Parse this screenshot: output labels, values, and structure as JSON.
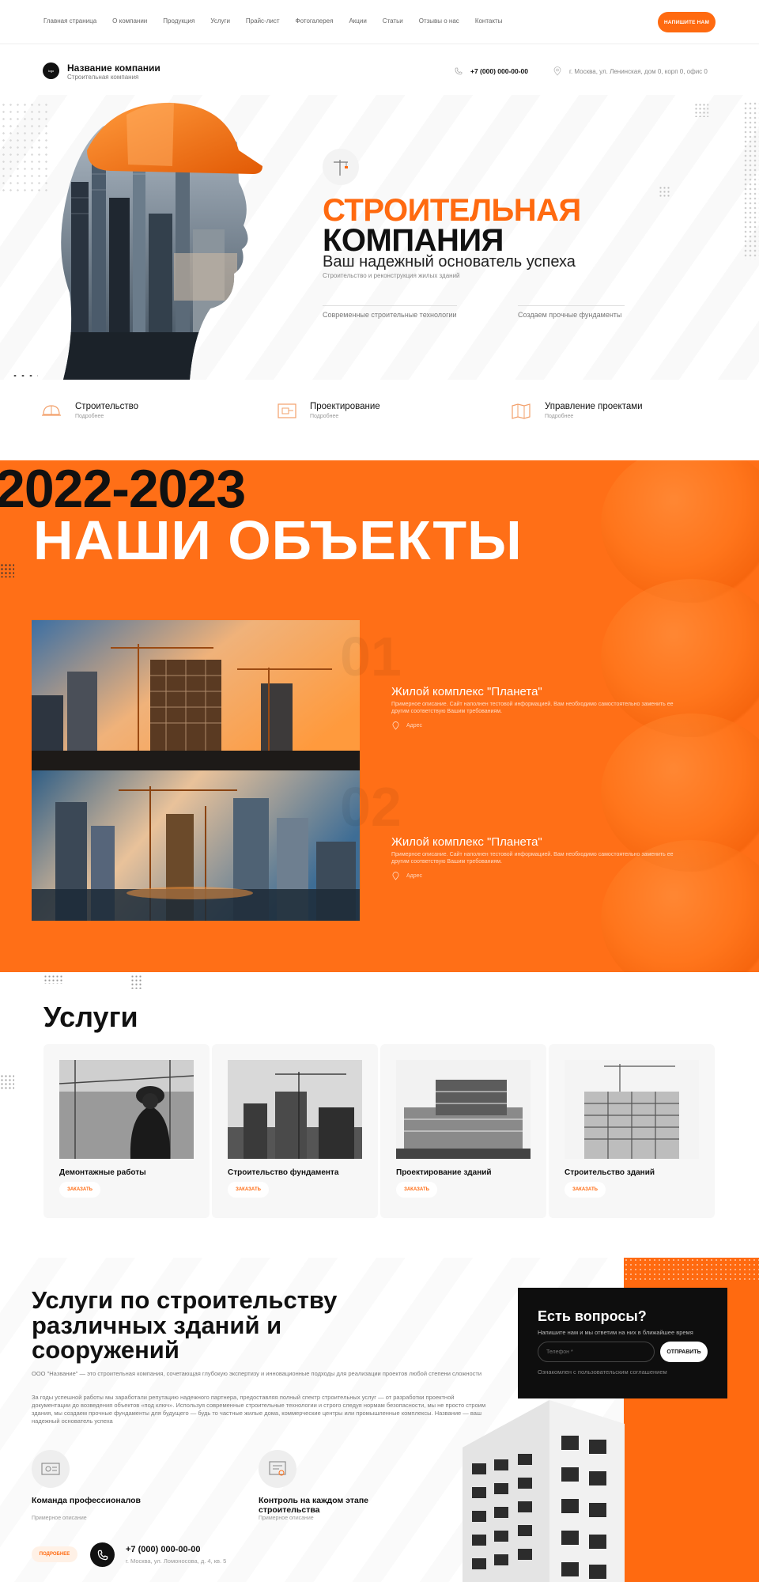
{
  "nav": {
    "items": [
      "Главная страница",
      "О компании",
      "Продукция",
      "Услуги",
      "Прайс-лист",
      "Фотогалерея",
      "Акции",
      "Статьи",
      "Отзывы о нас",
      "Контакты"
    ],
    "cta": "НАПИШИТЕ НАМ"
  },
  "header": {
    "logo_text": "logo",
    "company_name": "Название компании",
    "company_sub": "Строительная компания",
    "phone": "+7 (000) 000-00-00",
    "address": "г. Москва, ул. Ленинская, дом 0, корп 0, офис 0"
  },
  "hero": {
    "title_line1": "СТРОИТЕЛЬНАЯ",
    "title_line2": "КОМПАНИЯ",
    "tagline": "Ваш надежный основатель успеха",
    "subtitle": "Строительство и реконструкция жилых зданий",
    "feature1": "Современные строительные технологии",
    "feature2": "Создаем прочные фундаменты"
  },
  "services_strip": [
    {
      "title": "Строительство",
      "more": "Подробнее"
    },
    {
      "title": "Проектирование",
      "more": "Подробнее"
    },
    {
      "title": "Управление проектами",
      "more": "Подробнее"
    }
  ],
  "objects": {
    "year": "2022-2023",
    "title": "НАШИ ОБЪЕКТЫ",
    "items": [
      {
        "num": "01",
        "title": "Жилой комплекс \"Планета\"",
        "desc": "Примерное описание. Сайт наполнен тестовой информацией. Вам необходимо самостоятельно заменить ее другим соответствую Вашим требованиям.",
        "address": "Адрес"
      },
      {
        "num": "02",
        "title": "Жилой комплекс \"Планета\"",
        "desc": "Примерное описание. Сайт наполнен тестовой информацией. Вам необходимо самостоятельно заменить ее другим соответствую Вашим требованиям.",
        "address": "Адрес"
      }
    ]
  },
  "services": {
    "title": "Услуги",
    "cards": [
      {
        "title": "Демонтажные работы",
        "button": "ЗАКАЗАТЬ"
      },
      {
        "title": "Строительство фундамента",
        "button": "ЗАКАЗАТЬ"
      },
      {
        "title": "Проектирование зданий",
        "button": "ЗАКАЗАТЬ"
      },
      {
        "title": "Строительство зданий",
        "button": "ЗАКАЗАТЬ"
      }
    ]
  },
  "about": {
    "title": "Услуги по строительству различных зданий и сооружений",
    "para1": "ООО \"Название\" — это строительная компания, сочетающая глубокую экспертизу и инновационные подходы для реализации проектов любой степени сложности",
    "para2": "За годы успешной работы мы заработали репутацию надежного партнера, предоставляя полный спектр строительных услуг — от разработки проектной документации до возведения объектов «под ключ». Используя современные строительные технологии и строго следуя нормам безопасности, мы не просто строим здания, мы создаем прочные фундаменты для будущего — будь то частные жилые дома, коммерческие центры или промышленные комплексы. Название — ваш надежный основатель успеха",
    "feature1_title": "Команда профессионалов",
    "feature1_sub": "Примерное описание",
    "feature2_title": "Контроль на каждом этапе строительства",
    "feature2_sub": "Примерное описание",
    "more_button": "ПОДРОБНЕЕ",
    "phone": "+7 (000) 000-00-00",
    "address": "г. Москва, ул. Ломоносова, д. 4, кв. 5"
  },
  "questions": {
    "title": "Есть вопросы?",
    "subtitle": "Напишите нам и мы ответим на них в ближайшее время",
    "input_placeholder": "Телефон *",
    "button": "ОТПРАВИТЬ",
    "note": "Ознакомлен с пользовательским соглашением"
  },
  "colors": {
    "accent": "#ff6a10",
    "dark": "#111111",
    "light_bg": "#f7f7f7"
  }
}
